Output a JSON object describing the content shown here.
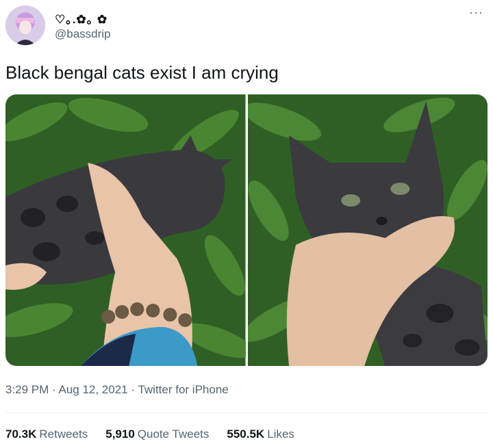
{
  "author": {
    "display_name": "♡｡.✿｡ ✿",
    "handle": "@bassdrip"
  },
  "more_menu": "···",
  "tweet": {
    "text": "Black bengal cats exist I am crying"
  },
  "meta": {
    "time": "3:29 PM",
    "sep1": " · ",
    "date": "Aug 12, 2021",
    "sep2": " · ",
    "client": "Twitter for iPhone"
  },
  "stats": [
    {
      "num": "70.3K",
      "label": "Retweets"
    },
    {
      "num": "5,910",
      "label": "Quote Tweets"
    },
    {
      "num": "550.5K",
      "label": "Likes"
    }
  ],
  "colors": {
    "text": "#0f1419",
    "secondary": "#536471",
    "leaf": "#3f7a2a"
  }
}
